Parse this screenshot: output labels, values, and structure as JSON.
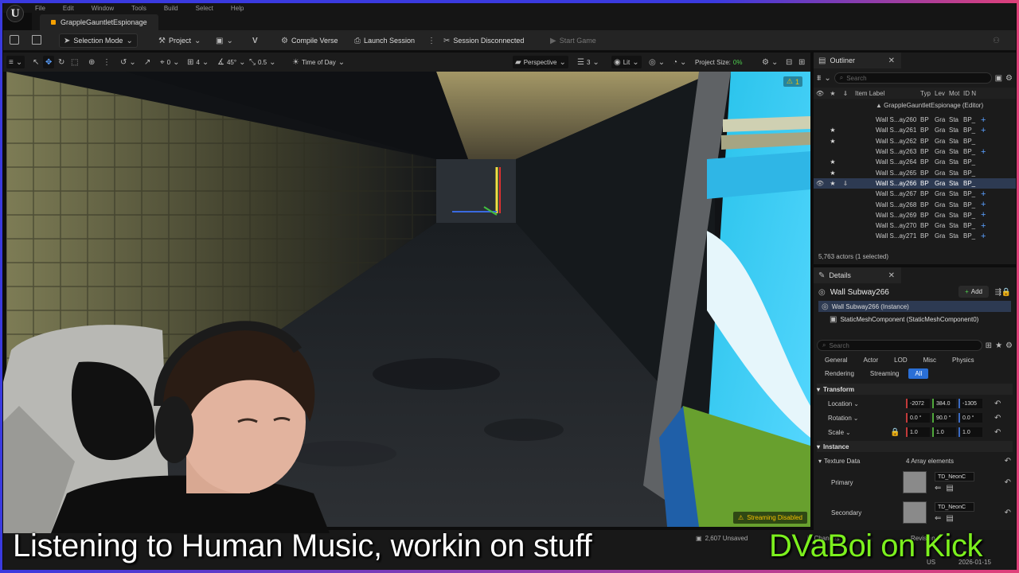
{
  "menu": [
    "File",
    "Edit",
    "Window",
    "Tools",
    "Build",
    "Select",
    "Help"
  ],
  "document_tab": "GrappleGauntletEspionage",
  "toolbar": {
    "selection_mode": "Selection Mode",
    "project": "Project",
    "compile": "Compile Verse",
    "launch": "Launch Session",
    "session_status": "Session Disconnected",
    "start_game": "Start Game"
  },
  "viewport_toolbar": {
    "rot_value": "0",
    "snap_value": "4",
    "angle": "45°",
    "scale": "0.5",
    "time_of_day": "Time of Day",
    "perspective": "Perspective",
    "cams": "3",
    "lit": "Lit",
    "project_size_label": "Project Size:",
    "project_size_value": "0%"
  },
  "viewport": {
    "warnings": "1",
    "streaming": "Streaming Disabled"
  },
  "outliner": {
    "title": "Outliner",
    "search_placeholder": "Search",
    "columns": {
      "label": "Item Label",
      "type": "Typ",
      "level": "Lev",
      "mobility": "Mot",
      "id": "ID N"
    },
    "root": "GrappleGauntletEspionage (Editor)",
    "rows": [
      {
        "name": "Wall S...ay260",
        "star": "",
        "pin": "",
        "typ": "BP",
        "lev": "Gra",
        "mob": "Sta",
        "id": "BP_",
        "plus": "+"
      },
      {
        "name": "Wall S...ay261",
        "star": "★",
        "pin": "",
        "typ": "BP",
        "lev": "Gra",
        "mob": "Sta",
        "id": "BP_",
        "plus": "+"
      },
      {
        "name": "Wall S...ay262",
        "star": "★",
        "pin": "",
        "typ": "BP",
        "lev": "Gra",
        "mob": "Sta",
        "id": "BP_",
        "plus": ""
      },
      {
        "name": "Wall S...ay263",
        "star": "",
        "pin": "",
        "typ": "BP",
        "lev": "Gra",
        "mob": "Sta",
        "id": "BP_",
        "plus": "+"
      },
      {
        "name": "Wall S...ay264",
        "star": "★",
        "pin": "",
        "typ": "BP",
        "lev": "Gra",
        "mob": "Sta",
        "id": "BP_",
        "plus": ""
      },
      {
        "name": "Wall S...ay265",
        "star": "★",
        "pin": "",
        "typ": "BP",
        "lev": "Gra",
        "mob": "Sta",
        "id": "BP_",
        "plus": ""
      },
      {
        "name": "Wall S...ay266",
        "star": "★",
        "pin": "⇓",
        "typ": "BP",
        "lev": "Gra",
        "mob": "Sta",
        "id": "BP_",
        "plus": "",
        "selected": true
      },
      {
        "name": "Wall S...ay267",
        "star": "",
        "pin": "",
        "typ": "BP",
        "lev": "Gra",
        "mob": "Sta",
        "id": "BP_",
        "plus": "+"
      },
      {
        "name": "Wall S...ay268",
        "star": "",
        "pin": "",
        "typ": "BP",
        "lev": "Gra",
        "mob": "Sta",
        "id": "BP_",
        "plus": "+"
      },
      {
        "name": "Wall S...ay269",
        "star": "",
        "pin": "",
        "typ": "BP",
        "lev": "Gra",
        "mob": "Sta",
        "id": "BP_",
        "plus": "+"
      },
      {
        "name": "Wall S...ay270",
        "star": "",
        "pin": "",
        "typ": "BP",
        "lev": "Gra",
        "mob": "Sta",
        "id": "BP_",
        "plus": "+"
      },
      {
        "name": "Wall S...ay271",
        "star": "",
        "pin": "",
        "typ": "BP",
        "lev": "Gra",
        "mob": "Sta",
        "id": "BP_",
        "plus": "+"
      }
    ],
    "footer": "5,763 actors (1 selected)"
  },
  "details": {
    "title": "Details",
    "actor_name": "Wall Subway266",
    "add_label": "Add",
    "instance_label": "Wall Subway266 (Instance)",
    "component_label": "StaticMeshComponent (StaticMeshComponent0)",
    "search_placeholder": "Search",
    "filter_tabs": [
      "General",
      "Actor",
      "LOD",
      "Misc",
      "Physics",
      "Rendering",
      "Streaming",
      "All"
    ],
    "active_filter": "All",
    "transform_header": "Transform",
    "location": {
      "label": "Location",
      "x": "-2072",
      "y": "384.0",
      "z": "-1305"
    },
    "rotation": {
      "label": "Rotation",
      "x": "0.0 °",
      "y": "90.0 °",
      "z": "0.0 °"
    },
    "scale": {
      "label": "Scale",
      "x": "1.0",
      "y": "1.0",
      "z": "1.0"
    },
    "instance_header": "Instance",
    "texture_data_label": "Texture Data",
    "texture_data_value": "4 Array elements",
    "primary_label": "Primary",
    "primary_value": "TD_NeonC",
    "secondary_label": "Secondary",
    "secondary_value": "TD_NeonC"
  },
  "status": {
    "unsaved": "2,607 Unsaved",
    "source_control": "Revision C",
    "changes": "in Changes",
    "date": "2026-01-15",
    "locale": "US"
  },
  "overlay": {
    "caption": "Listening to Human Music, workin on stuff",
    "brand": "DVaBoi on Kick"
  },
  "colors": {
    "accent": "#2a6fd6",
    "brand_green": "#7cf01e",
    "warning": "#f5c000"
  }
}
